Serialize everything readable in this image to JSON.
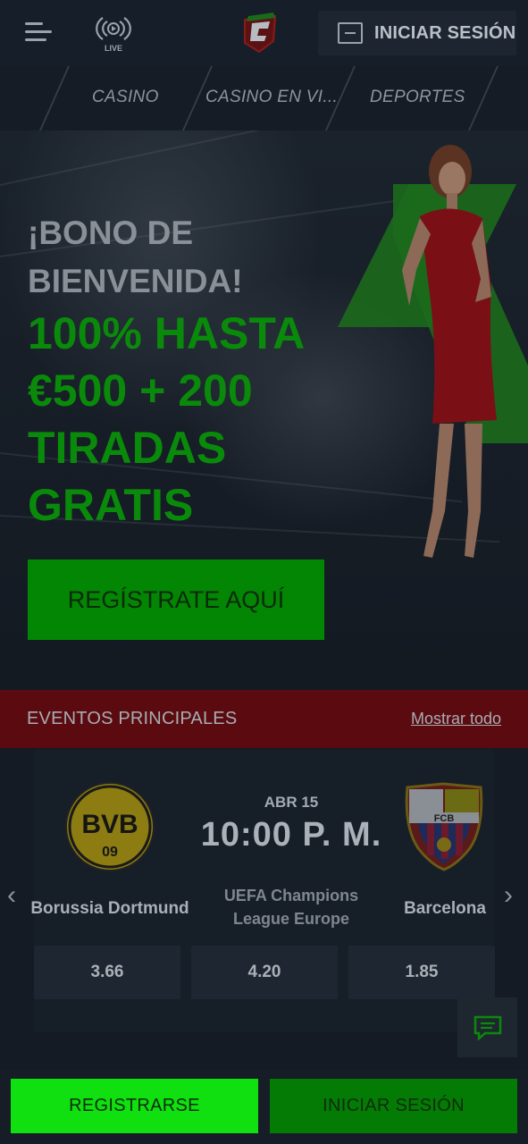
{
  "header": {
    "live_label": "LIVE",
    "login_label": "INICIAR SESIÓN"
  },
  "nav": {
    "items": [
      {
        "label": "CASINO"
      },
      {
        "label": "CASINO EN VI..."
      },
      {
        "label": "DEPORTES"
      }
    ]
  },
  "hero": {
    "headline_line1": "¡BONO DE",
    "headline_line2": "BIENVENIDA!",
    "offer_line1": "100% HASTA",
    "offer_line2": "€500 + 200",
    "offer_line3": "TIRADAS",
    "offer_line4": "GRATIS",
    "cta_label": "REGÍSTRATE AQUÍ"
  },
  "events": {
    "title": "EVENTOS PRINCIPALES",
    "show_all": "Mostrar todo"
  },
  "match": {
    "date": "ABR 15",
    "time": "10:00 P. M.",
    "league_line1": "UEFA Champions",
    "league_line2": "League Europe",
    "home_team": "Borussia Dortmund",
    "away_team": "Barcelona",
    "home_logo_text": "BVB",
    "home_logo_sub": "09",
    "away_logo_text": "FCB",
    "odds": [
      "3.66",
      "4.20",
      "1.85"
    ]
  },
  "bottom": {
    "register_label": "REGISTRARSE",
    "login_label": "INICIAR SESIÓN"
  },
  "colors": {
    "accent_green": "#10e010",
    "dark_green": "#047b04",
    "events_red": "#5b0b0f",
    "background": "#141b25"
  }
}
